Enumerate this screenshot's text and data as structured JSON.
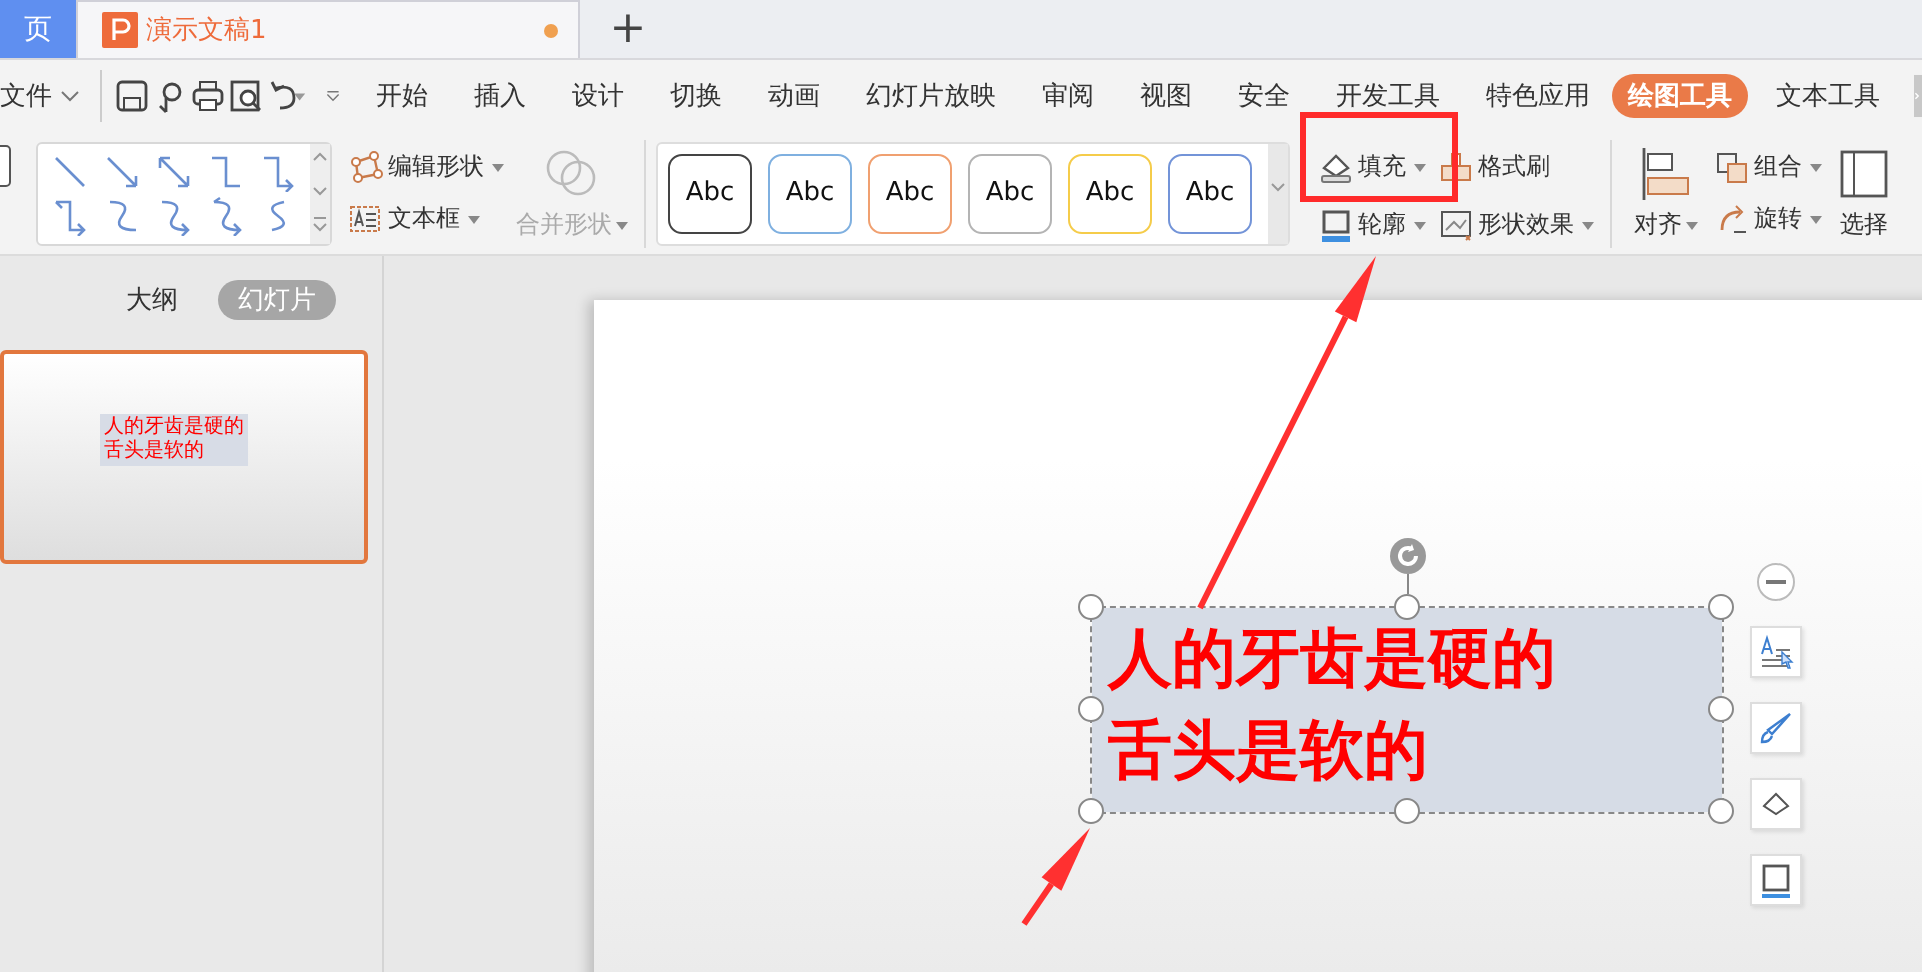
{
  "tabs": [
    {
      "label": "页",
      "kind": "home"
    },
    {
      "label": "演示文稿1",
      "kind": "doc",
      "unsaved": true
    }
  ],
  "new_tab": "+",
  "menu": {
    "file": "文件",
    "items": [
      {
        "label": "开始",
        "selected": false
      },
      {
        "label": "插入",
        "selected": false
      },
      {
        "label": "设计",
        "selected": false
      },
      {
        "label": "切换",
        "selected": false
      },
      {
        "label": "动画",
        "selected": false
      },
      {
        "label": "幻灯片放映",
        "selected": false
      },
      {
        "label": "审阅",
        "selected": false
      },
      {
        "label": "视图",
        "selected": false
      },
      {
        "label": "安全",
        "selected": false
      },
      {
        "label": "开发工具",
        "selected": false
      },
      {
        "label": "特色应用",
        "selected": false
      },
      {
        "label": "绘图工具",
        "selected": true
      },
      {
        "label": "文本工具",
        "selected": false
      }
    ]
  },
  "ribbon": {
    "shape_tools": [
      {
        "label": "编辑形状",
        "dropdown": true
      },
      {
        "label": "文本框",
        "dropdown": true
      }
    ],
    "merge": {
      "label": "合并形状",
      "dropdown": true,
      "disabled": true
    },
    "style_presets": [
      {
        "text": "Abc",
        "color": "#444444"
      },
      {
        "text": "Abc",
        "color": "#7fb0e0"
      },
      {
        "text": "Abc",
        "color": "#f0a070"
      },
      {
        "text": "Abc",
        "color": "#b4b4b4"
      },
      {
        "text": "Abc",
        "color": "#f5cc4a"
      },
      {
        "text": "Abc",
        "color": "#7394d8"
      }
    ],
    "format_tools": [
      {
        "label": "填充",
        "dropdown": true
      },
      {
        "label": "格式刷",
        "dropdown": false
      },
      {
        "label": "轮廓",
        "dropdown": true
      },
      {
        "label": "形状效果",
        "dropdown": true
      }
    ],
    "align": {
      "label": "对齐",
      "dropdown": true
    },
    "arrange_tools": [
      {
        "label": "组合",
        "dropdown": true
      },
      {
        "label": "旋转",
        "dropdown": true
      }
    ],
    "select": {
      "label": "选择"
    }
  },
  "panel": {
    "tabs": [
      {
        "label": "大纲",
        "selected": false
      },
      {
        "label": "幻灯片",
        "selected": true
      }
    ],
    "slides": [
      {
        "selected": true,
        "lines": [
          "人的牙齿是硬的",
          "舌头是软的"
        ]
      }
    ]
  },
  "slide": {
    "text_box": {
      "selected": true,
      "lines": [
        "人的牙齿是硬的",
        "舌头是软的"
      ]
    }
  },
  "annotations": [
    {
      "kind": "box"
    },
    {
      "kind": "arrow"
    },
    {
      "kind": "arrow"
    }
  ]
}
